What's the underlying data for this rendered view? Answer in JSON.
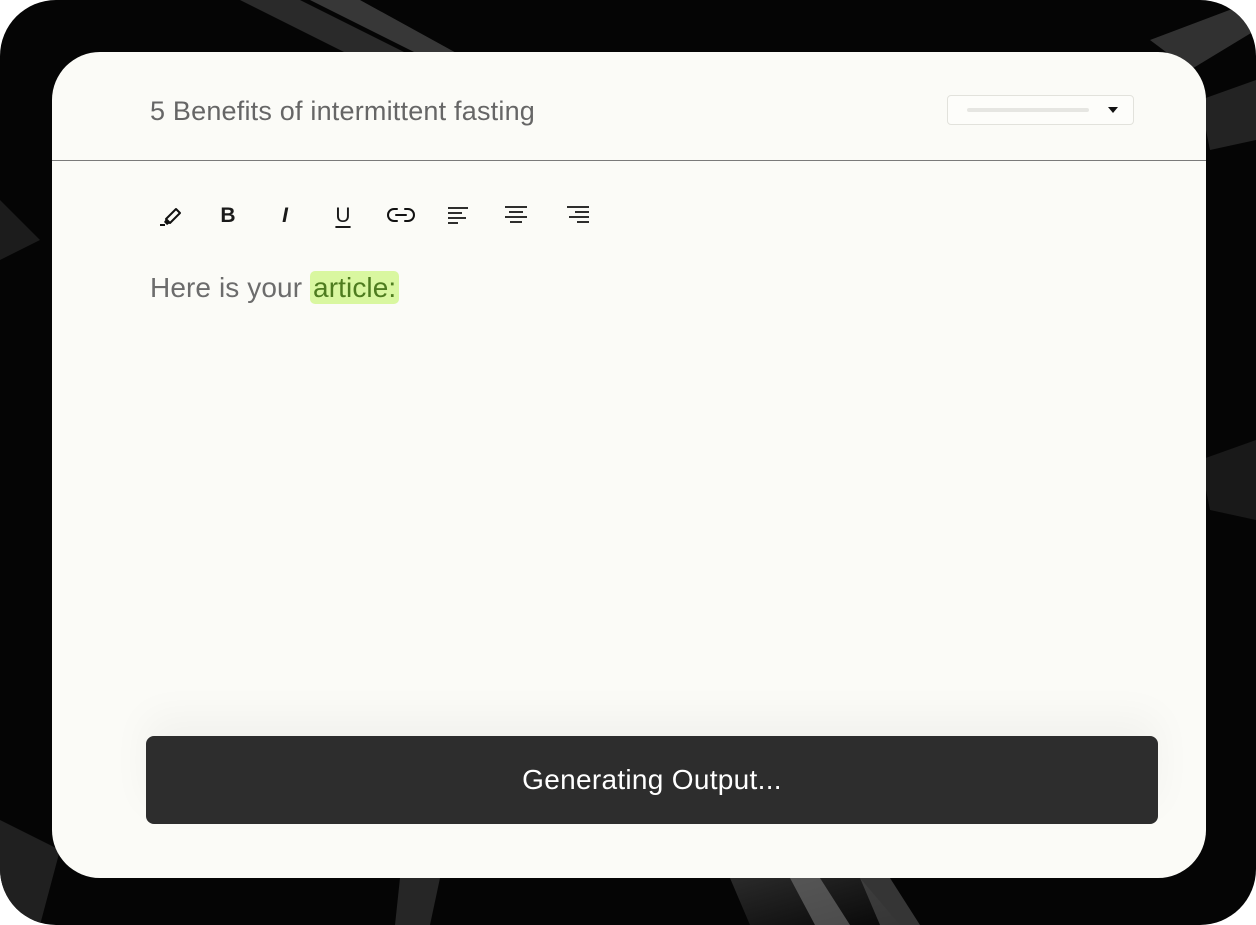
{
  "document": {
    "title": "5 Benefits of intermittent fasting"
  },
  "format_selector": {
    "icon": "caret-down-icon"
  },
  "toolbar": {
    "tools": [
      {
        "name": "highlighter",
        "icon": "highlighter-icon"
      },
      {
        "name": "bold",
        "label": "B"
      },
      {
        "name": "italic",
        "label": "I"
      },
      {
        "name": "underline",
        "label": "U"
      },
      {
        "name": "link",
        "icon": "link-icon"
      },
      {
        "name": "align-left",
        "icon": "align-left-icon"
      },
      {
        "name": "align-center",
        "icon": "align-center-icon"
      },
      {
        "name": "align-right",
        "icon": "align-right-icon"
      }
    ]
  },
  "editor": {
    "text_prefix": "Here is your ",
    "highlighted_text": "article:",
    "highlight_color": "#d9f7a0"
  },
  "action": {
    "button_label": "Generating Output..."
  },
  "colors": {
    "background": "#050505",
    "card": "#fbfbf7",
    "button": "#2d2d2d",
    "highlight": "#d9f7a0"
  }
}
